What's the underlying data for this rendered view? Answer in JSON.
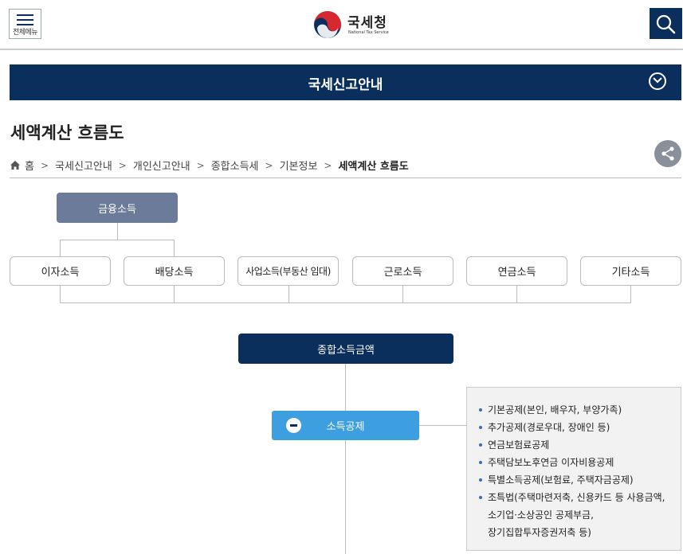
{
  "header": {
    "menu_label": "전체메뉴",
    "logo_kr": "국세청",
    "logo_en": "National Tax Service"
  },
  "banner": {
    "title": "국세신고안내"
  },
  "page_title": "세액계산 흐름도",
  "breadcrumb": [
    "홈",
    "국세신고안내",
    "개인신고안내",
    "종합소득세",
    "기본정보",
    "세액계산 흐름도"
  ],
  "diagram": {
    "top_box": "금융소득",
    "income_types": [
      "이자소득",
      "배당소득",
      "사업소득(부동산 임대)",
      "근로소득",
      "연금소득",
      "기타소득"
    ],
    "total_box": "종합소득금액",
    "deduction_box": "소득공제",
    "deduction_items": [
      "기본공제(본인, 배우자, 부양가족)",
      "추가공제(경로우대, 장애인 등)",
      "연금보험료공제",
      "주택담보노후연금 이자비용공제",
      "특별소득공제(보험료, 주택자금공제)",
      "조특법(주택마련저축, 신용카드 등 사용금액,",
      "소기업·소상공인 공제부금,",
      "장기집합투자증권저축 등)"
    ]
  },
  "colors": {
    "navy": "#0b2f5c",
    "slate": "#6b7b99",
    "blue": "#3d9ee0"
  }
}
